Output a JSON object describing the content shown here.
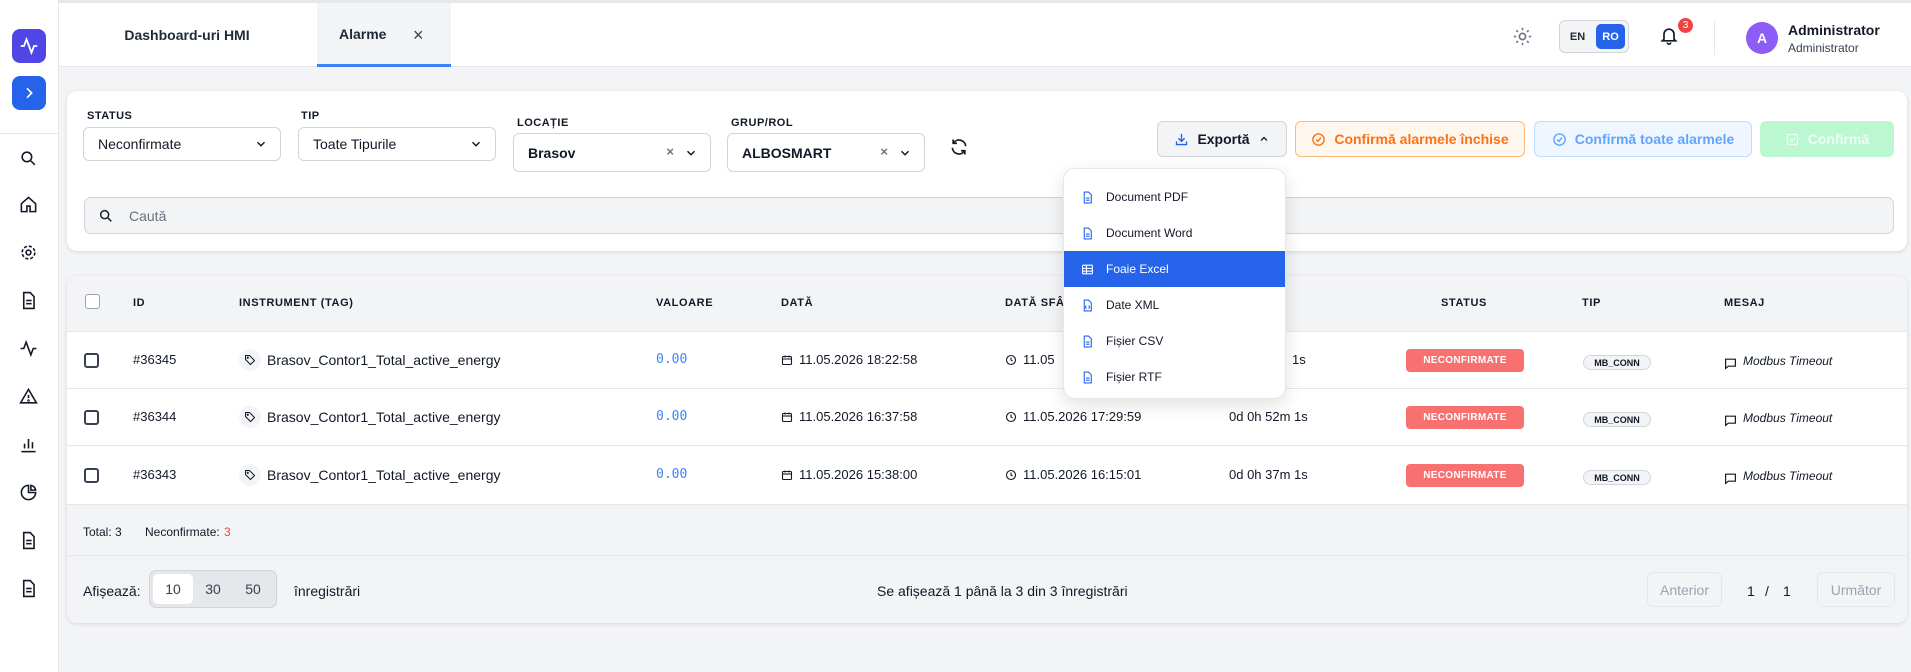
{
  "topbar": {
    "tabs": [
      {
        "label": "Dashboard-uri HMI"
      },
      {
        "label": "Alarme",
        "close": "×"
      }
    ],
    "lang": {
      "en": "EN",
      "ro": "RO"
    },
    "notifications_count": "3",
    "user": {
      "initial": "A",
      "name": "Administrator",
      "role": "Administrator"
    }
  },
  "filters": {
    "status": {
      "label": "STATUS",
      "value": "Neconfirmate"
    },
    "tip": {
      "label": "TIP",
      "value": "Toate Tipurile"
    },
    "locatie": {
      "label": "LOCAȚIE",
      "value": "Brasov",
      "clear": "×"
    },
    "grup": {
      "label": "GRUP/ROL",
      "value": "ALBOSMART",
      "clear": "×"
    },
    "export_label": "Exportă",
    "confirm_closed_label": "Confirmă alarmele închise",
    "confirm_all_label": "Confirmă toate alarmele",
    "confirm_label": "Confirmă",
    "search_placeholder": "Caută"
  },
  "export_menu": [
    {
      "label": "Document PDF",
      "icon": "file-text-icon"
    },
    {
      "label": "Document Word",
      "icon": "file-text-icon"
    },
    {
      "label": "Foaie Excel",
      "icon": "table-icon",
      "highlighted": true
    },
    {
      "label": "Date XML",
      "icon": "file-code-icon"
    },
    {
      "label": "Fișier CSV",
      "icon": "file-text-icon"
    },
    {
      "label": "Fișier RTF",
      "icon": "file-text-icon"
    }
  ],
  "table": {
    "headers": {
      "id": "ID",
      "instrument": "INSTRUMENT (TAG)",
      "valoare": "VALOARE",
      "data": "DATĂ",
      "data_sf": "DATĂ SFÂ",
      "status": "STATUS",
      "tip": "TIP",
      "mesaj": "MESAJ"
    },
    "rows": [
      {
        "id": "#36345",
        "instrument": "Brasov_Contor1_Total_active_energy",
        "value": "0.00",
        "date": "11.05.2026 18:22:58",
        "end_date": "11.05",
        "duration": "1s",
        "status": "NECONFIRMATE",
        "type": "MB_CONN",
        "message": "Modbus Timeout"
      },
      {
        "id": "#36344",
        "instrument": "Brasov_Contor1_Total_active_energy",
        "value": "0.00",
        "date": "11.05.2026 16:37:58",
        "end_date": "11.05.2026 17:29:59",
        "duration": "0d 0h 52m 1s",
        "status": "NECONFIRMATE",
        "type": "MB_CONN",
        "message": "Modbus Timeout"
      },
      {
        "id": "#36343",
        "instrument": "Brasov_Contor1_Total_active_energy",
        "value": "0.00",
        "date": "11.05.2026 15:38:00",
        "end_date": "11.05.2026 16:15:01",
        "duration": "0d 0h 37m 1s",
        "status": "NECONFIRMATE",
        "type": "MB_CONN",
        "message": "Modbus Timeout"
      }
    ],
    "totals": {
      "total_label": "Total:",
      "total_value": "3",
      "unconfirmed_label": "Neconfirmate:",
      "unconfirmed_value": "3"
    }
  },
  "pagination": {
    "show_label": "Afișează:",
    "sizes": [
      "10",
      "30",
      "50"
    ],
    "records_label": "înregistrări",
    "summary": "Se afișează 1 până la 3 din 3 înregistrări",
    "prev": "Anterior",
    "page": "1",
    "separator": "/",
    "pages": "1",
    "next": "Următor"
  },
  "colors": {
    "primary": "#2563eb",
    "danger": "#f87171",
    "warning": "#f97316",
    "success": "#bbf7d0"
  }
}
